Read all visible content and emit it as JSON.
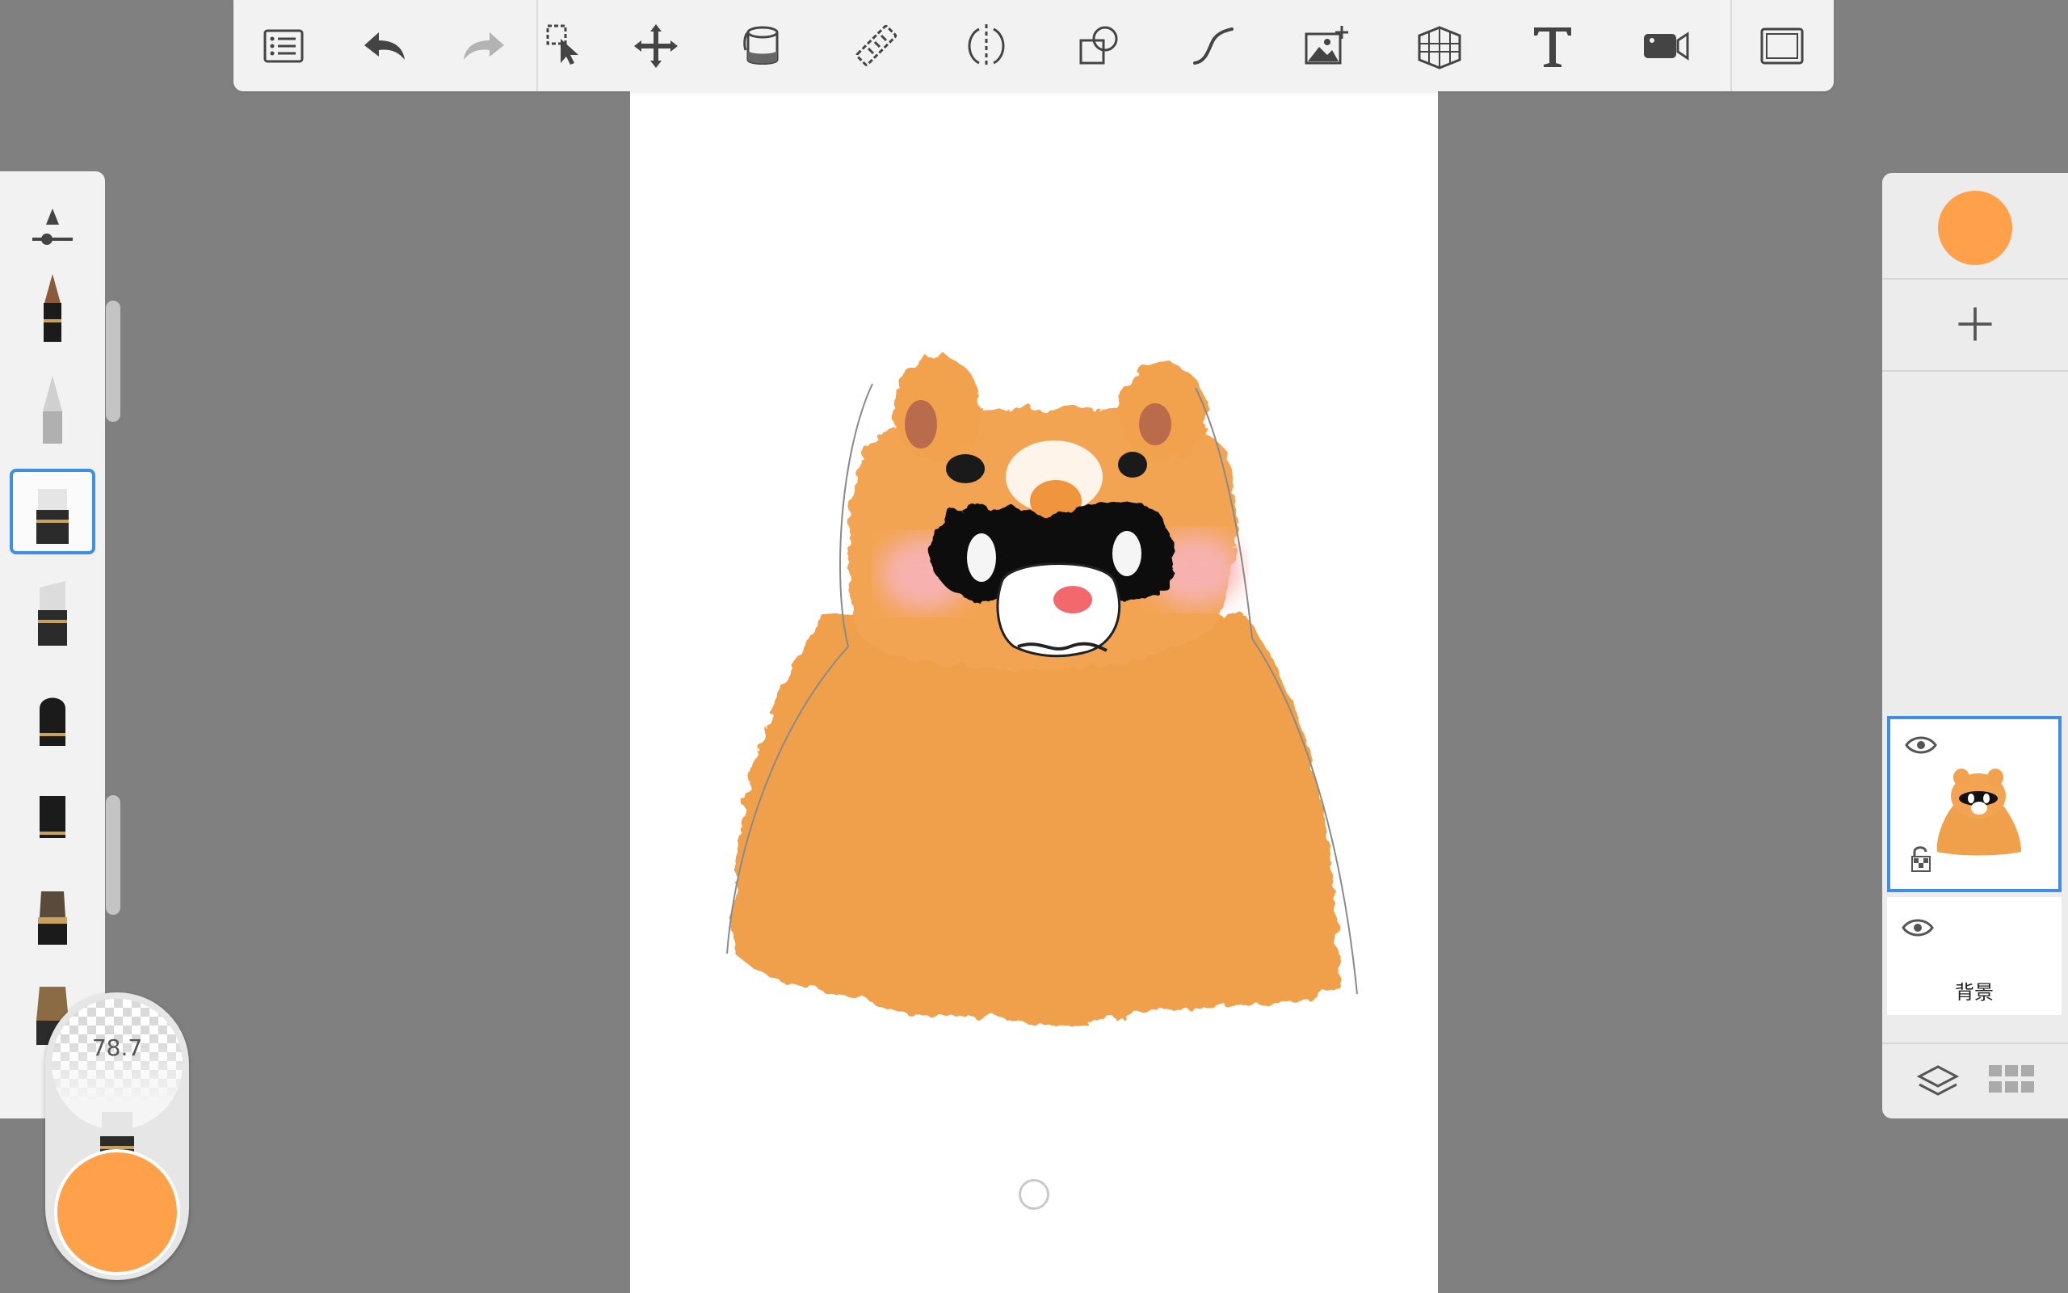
{
  "app": {
    "accent_color": "#3d8fe6",
    "current_color": "#ffa04a"
  },
  "top_toolbar": {
    "items": [
      {
        "name": "list-icon"
      },
      {
        "name": "undo-icon"
      },
      {
        "name": "redo-icon"
      },
      {
        "name": "selection-icon"
      },
      {
        "name": "transform-icon"
      },
      {
        "name": "fill-bucket-icon"
      },
      {
        "name": "ruler-icon"
      },
      {
        "name": "symmetry-icon"
      },
      {
        "name": "shapes-icon"
      },
      {
        "name": "stroke-curve-icon"
      },
      {
        "name": "add-image-icon"
      },
      {
        "name": "perspective-grid-icon"
      },
      {
        "name": "text-icon"
      },
      {
        "name": "time-lapse-icon"
      },
      {
        "name": "fullscreen-icon"
      }
    ]
  },
  "brush_panel": {
    "selected_index": 3,
    "brushes": [
      "pencil",
      "fineliner",
      "marker",
      "marker-alt",
      "airbrush",
      "chisel",
      "paintbrush",
      "flat-brush"
    ]
  },
  "puck": {
    "size_value": "78.7",
    "color": "#ffa04a"
  },
  "layers": {
    "items": [
      {
        "name": "drawing-layer",
        "visible": true,
        "selected": true
      },
      {
        "name": "background-layer",
        "label": "背景",
        "visible": true,
        "selected": false
      }
    ]
  }
}
